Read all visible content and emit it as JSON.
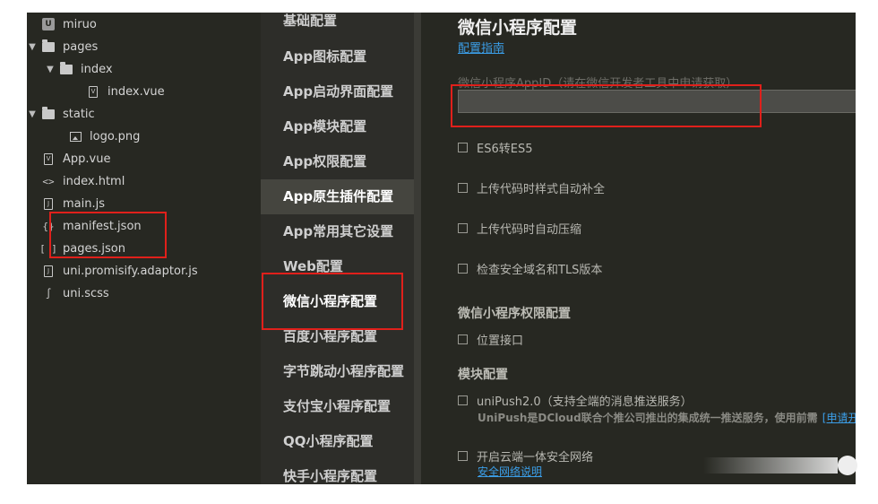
{
  "explorer": {
    "items": [
      {
        "label": "miruo",
        "icon": "project-root-icon"
      },
      {
        "label": "pages",
        "icon": "folder-icon"
      },
      {
        "label": "index",
        "icon": "folder-icon"
      },
      {
        "label": "index.vue",
        "icon": "vue-file-icon"
      },
      {
        "label": "static",
        "icon": "folder-icon"
      },
      {
        "label": "logo.png",
        "icon": "image-file-icon"
      },
      {
        "label": "App.vue",
        "icon": "vue-file-icon"
      },
      {
        "label": "index.html",
        "icon": "html-file-icon"
      },
      {
        "label": "main.js",
        "icon": "js-file-icon"
      },
      {
        "label": "manifest.json",
        "icon": "json-file-icon"
      },
      {
        "label": "pages.json",
        "icon": "json-file-icon"
      },
      {
        "label": "uni.promisify.adaptor.js",
        "icon": "js-file-icon"
      },
      {
        "label": "uni.scss",
        "icon": "scss-file-icon"
      }
    ]
  },
  "nav": {
    "items": [
      {
        "label": "基础配置"
      },
      {
        "label": "App图标配置"
      },
      {
        "label": "App启动界面配置"
      },
      {
        "label": "App模块配置"
      },
      {
        "label": "App权限配置"
      },
      {
        "label": "App原生插件配置"
      },
      {
        "label": "App常用其它设置"
      },
      {
        "label": "Web配置"
      },
      {
        "label": "微信小程序配置"
      },
      {
        "label": "百度小程序配置"
      },
      {
        "label": "字节跳动小程序配置"
      },
      {
        "label": "支付宝小程序配置"
      },
      {
        "label": "QQ小程序配置"
      },
      {
        "label": "快手小程序配置"
      }
    ],
    "active_index": 5
  },
  "content": {
    "title": "微信小程序配置",
    "guide_link": "配置指南",
    "appid_label": "微信小程序AppID（请在微信开发者工具中申请获取）",
    "appid_value": "",
    "options": [
      {
        "label": "ES6转ES5",
        "checked": false
      },
      {
        "label": "上传代码时样式自动补全",
        "checked": false
      },
      {
        "label": "上传代码时自动压缩",
        "checked": false
      },
      {
        "label": "检查安全域名和TLS版本",
        "checked": false
      }
    ],
    "permissions_title": "微信小程序权限配置",
    "permission_option": {
      "label": "位置接口",
      "checked": false
    },
    "modules_title": "模块配置",
    "module_unipush": {
      "label": "uniPush2.0（支持全端的消息推送服务）",
      "checked": false
    },
    "module_unipush_desc": "UniPush是DCloud联合个推公司推出的集成统一推送服务，使用前需",
    "module_unipush_link": "[申请开",
    "module_secure": {
      "label": "开启云端一体安全网络",
      "checked": false
    },
    "module_secure_link": "安全网络说明"
  },
  "colors": {
    "background": "#272822",
    "highlight": "#e0201b",
    "link": "#3b9ee8",
    "active_nav": "#45453f"
  }
}
